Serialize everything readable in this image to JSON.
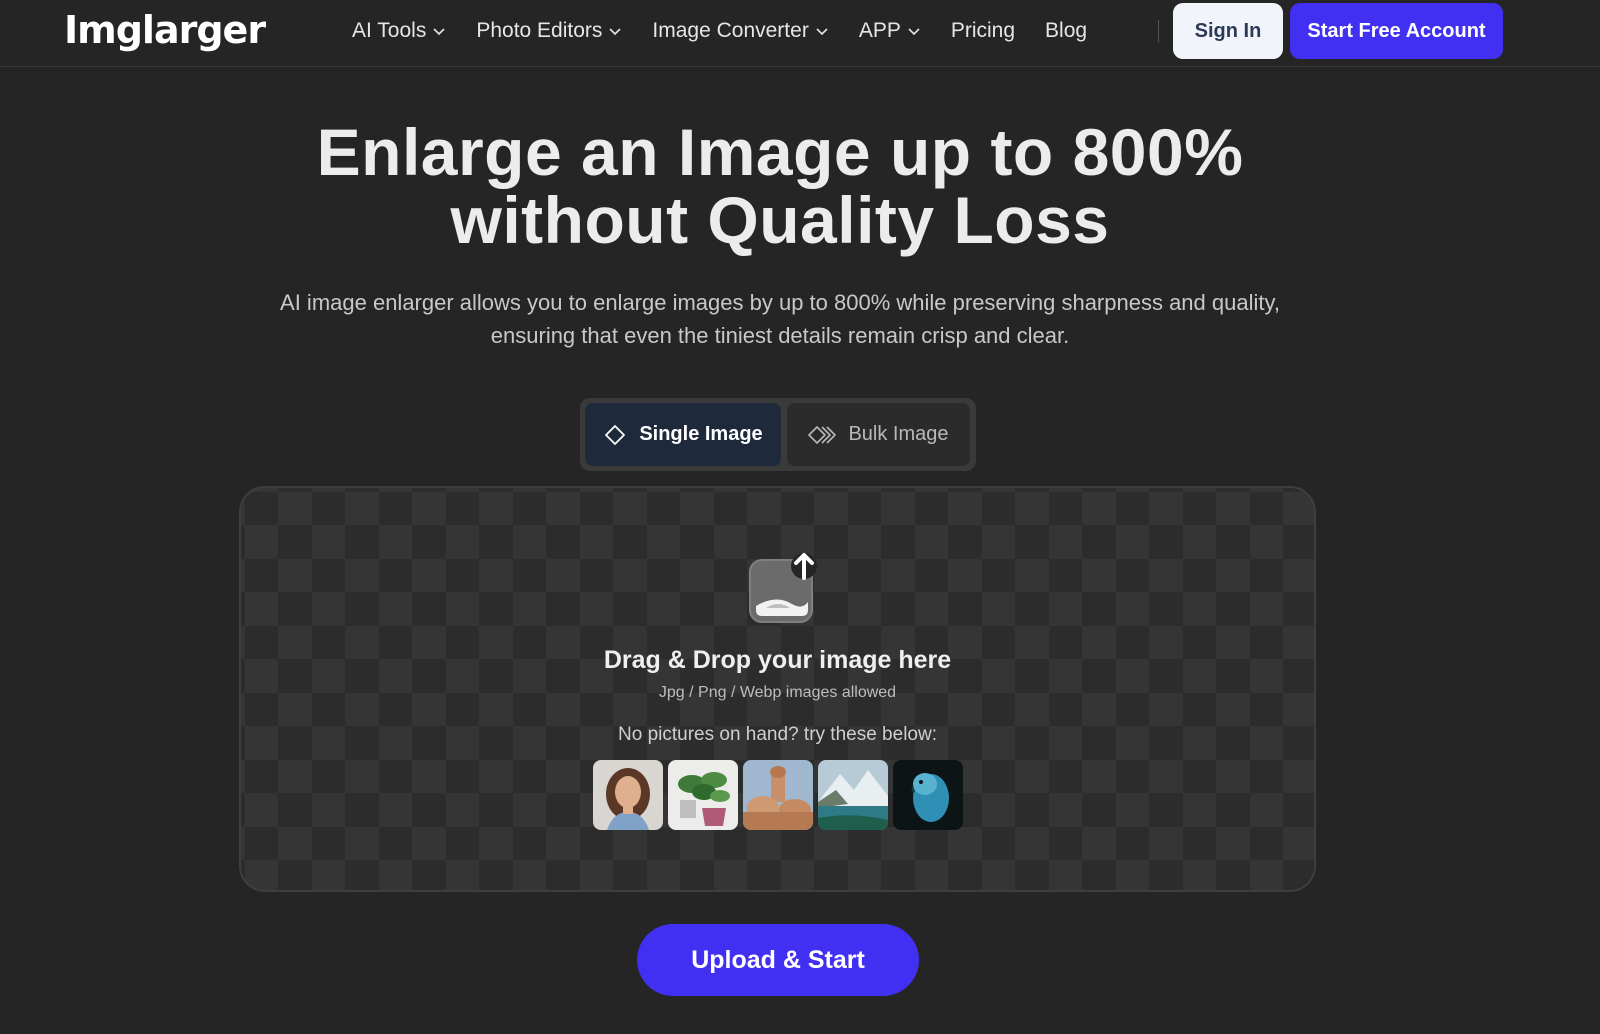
{
  "header": {
    "logo_text": "Imglarger",
    "nav": [
      {
        "label": "AI Tools",
        "dropdown": true
      },
      {
        "label": "Photo Editors",
        "dropdown": true
      },
      {
        "label": "Image Converter",
        "dropdown": true
      },
      {
        "label": "APP",
        "dropdown": true
      },
      {
        "label": "Pricing",
        "dropdown": false
      },
      {
        "label": "Blog",
        "dropdown": false
      }
    ],
    "sign_in_label": "Sign In",
    "start_label": "Start Free Account"
  },
  "hero": {
    "title_line1": "Enlarge an Image up to 800%",
    "title_line2": "without Quality Loss",
    "subtitle_line1": "AI image enlarger allows you to enlarge images by up to 800% while preserving sharpness and quality,",
    "subtitle_line2": "ensuring that even the tiniest details remain crisp and clear."
  },
  "mode_toggle": {
    "options": [
      {
        "label": "Single Image",
        "icon": "diamond-icon",
        "active": true
      },
      {
        "label": "Bulk Image",
        "icon": "double-diamond-icon",
        "active": false
      }
    ]
  },
  "dropzone": {
    "icon": "image-upload-icon",
    "title": "Drag & Drop your image here",
    "formats": "Jpg / Png / Webp images allowed",
    "try_text": "No pictures on hand? try these below:",
    "samples": [
      {
        "name": "sample-portrait-woman"
      },
      {
        "name": "sample-houseplant"
      },
      {
        "name": "sample-domed-building"
      },
      {
        "name": "sample-mountain-lake"
      },
      {
        "name": "sample-blue-parrot"
      }
    ]
  },
  "upload_button": {
    "label": "Upload & Start"
  },
  "colors": {
    "background": "#252525",
    "accent": "#4230f2",
    "toggle_active": "#1e2a3b"
  }
}
